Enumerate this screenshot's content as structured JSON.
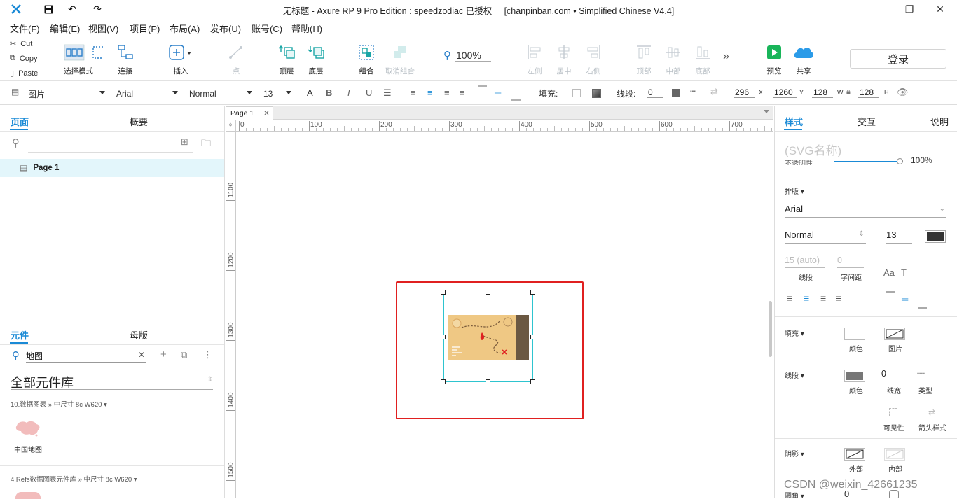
{
  "window": {
    "title": "无标题 - Axure RP 9 Pro Edition : speedzodiac 已授权     [chanpinban.com • Simplified Chinese V4.4]"
  },
  "menu": [
    "文件(F)",
    "编辑(E)",
    "视图(V)",
    "项目(P)",
    "布局(A)",
    "发布(U)",
    "账号(C)",
    "帮助(H)"
  ],
  "clipboard": {
    "cut": "Cut",
    "copy": "Copy",
    "paste": "Paste"
  },
  "toolbar": {
    "select_mode": "选择模式",
    "connect": "连接",
    "insert": "插入",
    "point": "点",
    "top_layer": "顶层",
    "bottom_layer": "底层",
    "group": "组合",
    "ungroup": "取消组合",
    "zoom": "100%",
    "align_left": "左侧",
    "align_center": "居中",
    "align_right": "右侧",
    "align_top": "顶部",
    "align_middle": "中部",
    "align_bottom": "底部",
    "preview": "预览",
    "share": "共享",
    "login": "登录"
  },
  "format": {
    "widget_type": "图片",
    "font": "Arial",
    "weight": "Normal",
    "size": "13",
    "fill_label": "填充:",
    "stroke_label": "线段:",
    "stroke_width": "0",
    "x": "296",
    "y": "1260",
    "w": "128",
    "h": "128",
    "x_label": "X",
    "y_label": "Y",
    "w_label": "W",
    "h_label": "H"
  },
  "left": {
    "tab_pages": "页面",
    "tab_outline": "概要",
    "page_name": "Page 1",
    "tab_widgets": "元件",
    "tab_masters": "母版",
    "search_value": "地图",
    "library_name": "全部元件库",
    "lib1_caption": "10.数据图表 » 中尺寸 8c  W620 ▾",
    "widget1_name": "中国地图",
    "lib2_caption": "4.Refs数据图表元件库 » 中尺寸 8c  W620 ▾"
  },
  "canvas": {
    "tab": "Page 1",
    "hruler": [
      "0",
      "100",
      "200",
      "300",
      "400",
      "500",
      "600",
      "700"
    ],
    "vruler": [
      "1100",
      "1200",
      "1300",
      "1400",
      "1500"
    ]
  },
  "right": {
    "tab_style": "样式",
    "tab_interaction": "交互",
    "tab_notes": "说明",
    "name_placeholder": "(SVG名称)",
    "opacity_label": "不透明性",
    "opacity_value": "100%",
    "typography": "排版 ▾",
    "font": "Arial",
    "weight": "Normal",
    "size": "13",
    "line_spacing": "15 (auto)",
    "line_spacing_label": "线段",
    "char_spacing": "0",
    "char_spacing_label": "字间距",
    "fill_section": "填充 ▾",
    "fill_color_label": "颜色",
    "fill_image_label": "图片",
    "stroke_section": "线段 ▾",
    "stroke_color_label": "颜色",
    "stroke_width": "0",
    "stroke_width_label": "线宽",
    "stroke_type_label": "类型",
    "visibility_label": "可见性",
    "arrow_label": "箭头样式",
    "shadow_section": "阴影 ▾",
    "shadow_outer": "外部",
    "shadow_inner": "内部",
    "corner_section": "圆角 ▾",
    "corner_value": "0"
  },
  "watermark": "CSDN @weixin_42661235",
  "colors": {
    "accent": "#1a8ad6",
    "selection_red": "#e02020",
    "selection_cyan": "#2ec4cf",
    "page_highlight": "#e3f6fb",
    "preview_green": "#19b55a",
    "share_blue": "#2b9be8"
  }
}
